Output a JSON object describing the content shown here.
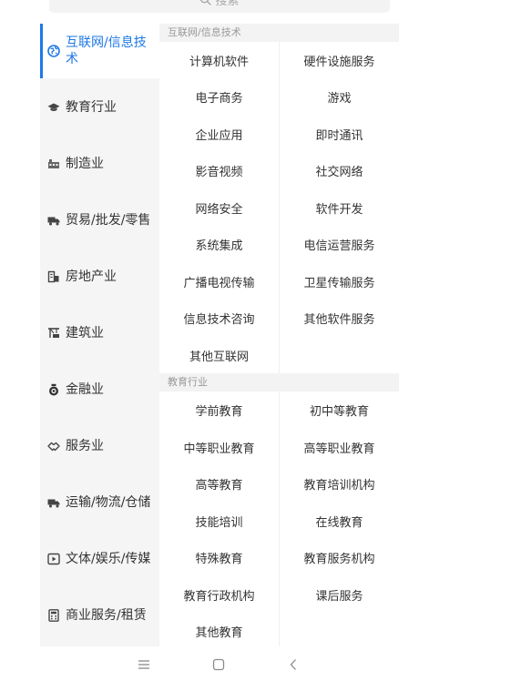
{
  "search": {
    "placeholder": "搜索",
    "icon": "search-icon"
  },
  "sidebar": {
    "accent_color": "#1e78e6",
    "items": [
      {
        "label": "互联网/信息技术",
        "icon": "globe-icon",
        "active": true
      },
      {
        "label": "教育行业",
        "icon": "graduation-cap-icon",
        "active": false
      },
      {
        "label": "制造业",
        "icon": "industry-icon",
        "active": false
      },
      {
        "label": "贸易/批发/零售",
        "icon": "truck-icon",
        "active": false
      },
      {
        "label": "房地产业",
        "icon": "building-icon",
        "active": false
      },
      {
        "label": "建筑业",
        "icon": "construction-icon",
        "active": false
      },
      {
        "label": "金融业",
        "icon": "money-bag-icon",
        "active": false
      },
      {
        "label": "服务业",
        "icon": "handshake-icon",
        "active": false
      },
      {
        "label": "运输/物流/仓储",
        "icon": "truck-icon",
        "active": false
      },
      {
        "label": "文体/娱乐/传媒",
        "icon": "play-icon",
        "active": false
      },
      {
        "label": "商业服务/租赁",
        "icon": "calculator-icon",
        "active": false
      }
    ]
  },
  "sections": [
    {
      "title": "互联网/信息技术",
      "items": [
        "计算机软件",
        "硬件设施服务",
        "电子商务",
        "游戏",
        "企业应用",
        "即时通讯",
        "影音视频",
        "社交网络",
        "网络安全",
        "软件开发",
        "系统集成",
        "电信运营服务",
        "广播电视传输",
        "卫星传输服务",
        "信息技术咨询",
        "其他软件服务",
        "其他互联网"
      ]
    },
    {
      "title": "教育行业",
      "items": [
        "学前教育",
        "初中等教育",
        "中等职业教育",
        "高等职业教育",
        "高等教育",
        "教育培训机构",
        "技能培训",
        "在线教育",
        "特殊教育",
        "教育服务机构",
        "教育行政机构",
        "课后服务",
        "其他教育"
      ]
    }
  ],
  "nav_bar": {
    "buttons": [
      {
        "icon": "menu-icon"
      },
      {
        "icon": "home-icon"
      },
      {
        "icon": "back-icon"
      }
    ]
  }
}
